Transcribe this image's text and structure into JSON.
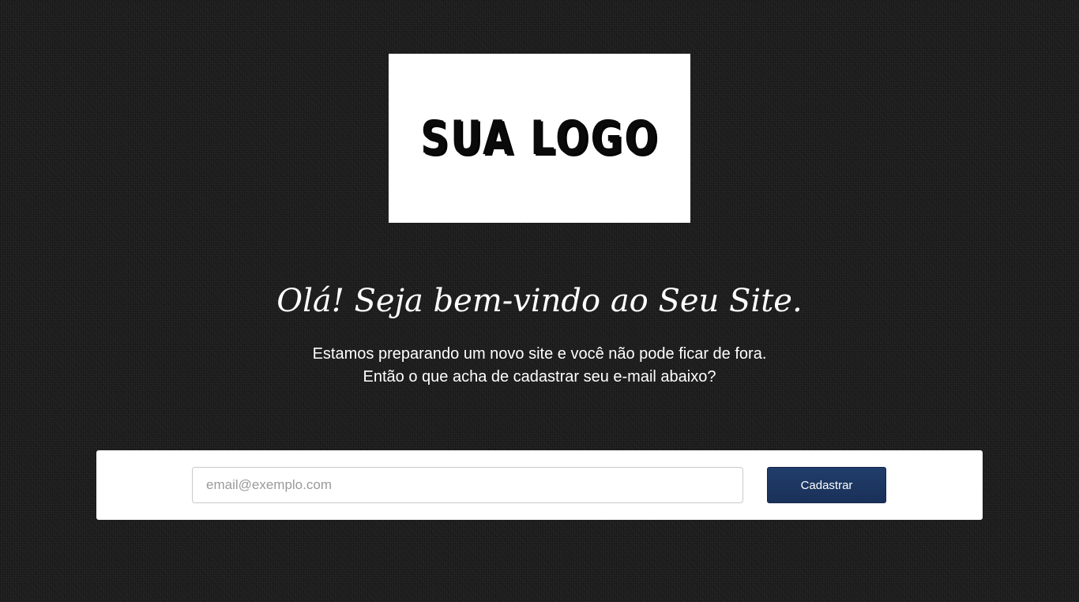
{
  "logo": {
    "text": "SUA LOGO"
  },
  "headline": "Olá! Seja bem-vindo ao Seu Site.",
  "subtitle": {
    "line1": "Estamos preparando um novo site e você não pode ficar de fora.",
    "line2": "Então o que acha de cadastrar seu e-mail abaixo?"
  },
  "signup_form": {
    "email_placeholder": "email@exemplo.com",
    "email_value": "",
    "submit_label": "Cadastrar"
  },
  "colors": {
    "background": "#1e1e1e",
    "button": "#1f3a66",
    "panel": "#ffffff"
  }
}
